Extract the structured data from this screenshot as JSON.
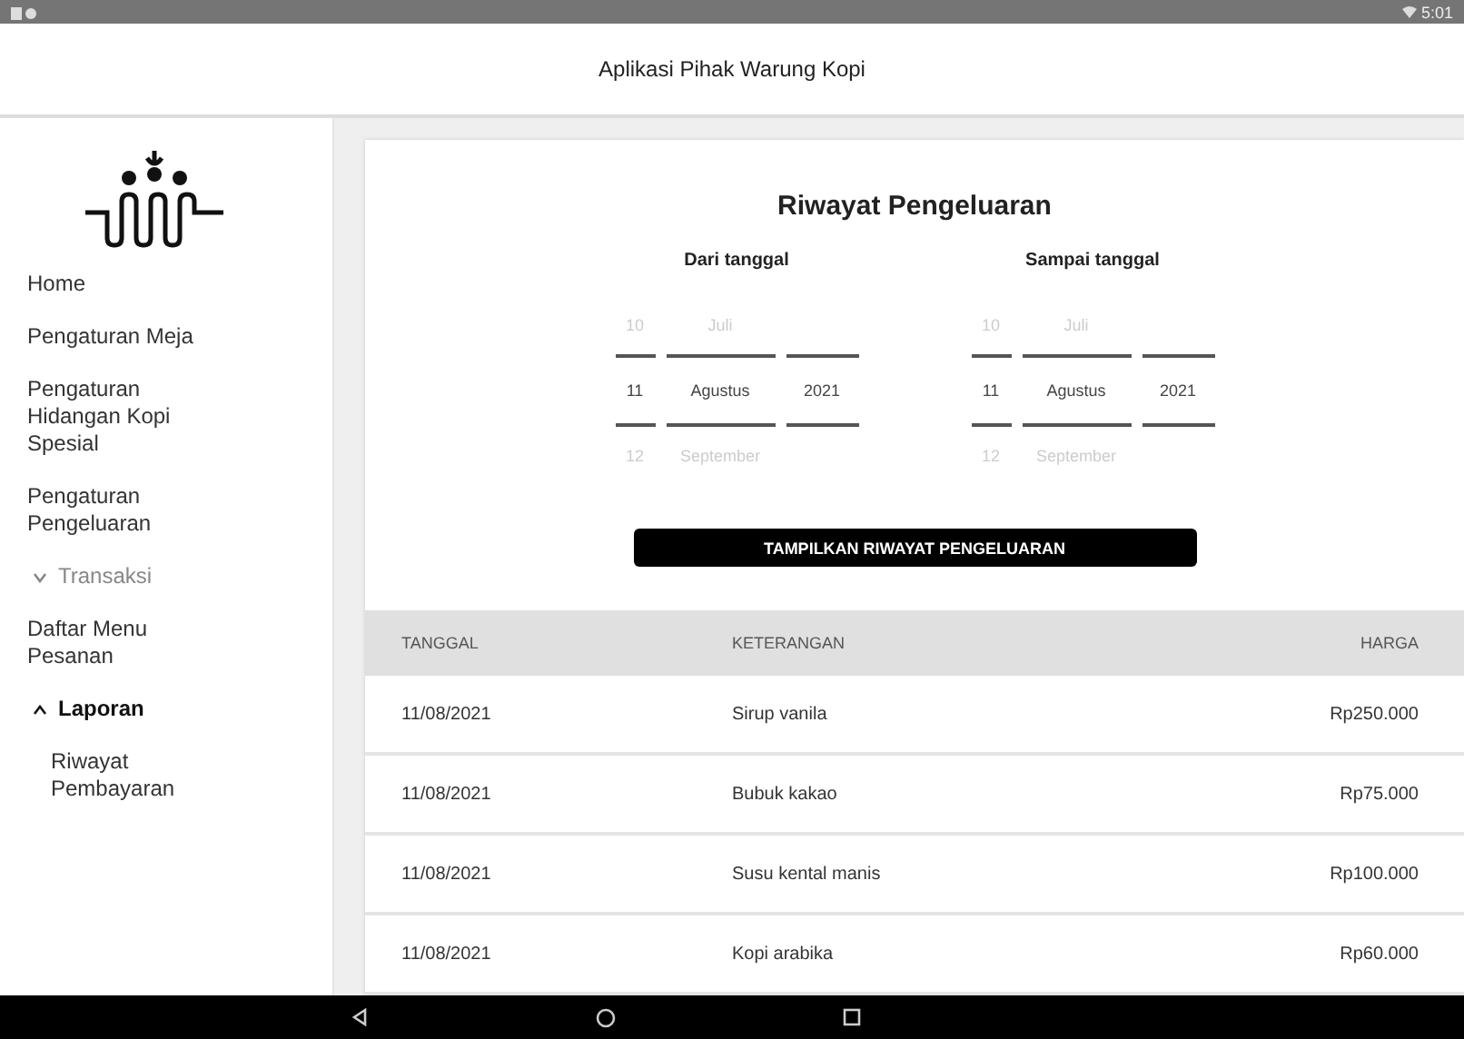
{
  "status_bar": {
    "time": "5:01"
  },
  "app_bar": {
    "title": "Aplikasi Pihak Warung Kopi"
  },
  "sidebar": {
    "items": [
      {
        "kind": "link",
        "label": "Home"
      },
      {
        "kind": "link",
        "label": "Pengaturan Meja"
      },
      {
        "kind": "link",
        "label": "Pengaturan Hidangan Kopi Spesial"
      },
      {
        "kind": "link",
        "label": "Pengaturan Pengeluaran"
      },
      {
        "kind": "group",
        "label": "Transaksi",
        "expanded": false
      },
      {
        "kind": "link",
        "label": "Daftar Menu Pesanan"
      },
      {
        "kind": "group",
        "label": "Laporan",
        "expanded": true,
        "children": [
          {
            "label": "Riwayat Pembayaran"
          }
        ]
      }
    ]
  },
  "card": {
    "title": "Riwayat Pengeluaran",
    "pickers": [
      {
        "label": "Dari tanggal",
        "rows": [
          {
            "day": "10",
            "month": "Juli",
            "selected": false
          },
          {
            "day": "11",
            "month": "Agustus",
            "year": "2021",
            "selected": true
          },
          {
            "day": "12",
            "month": "September",
            "selected": false
          }
        ]
      },
      {
        "label": "Sampai tanggal",
        "rows": [
          {
            "day": "10",
            "month": "Juli",
            "selected": false
          },
          {
            "day": "11",
            "month": "Agustus",
            "year": "2021",
            "selected": true
          },
          {
            "day": "12",
            "month": "September",
            "selected": false
          }
        ]
      }
    ],
    "button": "TAMPILKAN RIWAYAT PENGELUARAN"
  },
  "table": {
    "columns": [
      "TANGGAL",
      "KETERANGAN",
      "HARGA"
    ],
    "rows": [
      [
        "11/08/2021",
        "Sirup vanila",
        "Rp250.000"
      ],
      [
        "11/08/2021",
        "Bubuk kakao",
        "Rp75.000"
      ],
      [
        "11/08/2021",
        "Susu kental manis",
        "Rp100.000"
      ],
      [
        "11/08/2021",
        "Kopi arabika",
        "Rp60.000"
      ]
    ]
  }
}
